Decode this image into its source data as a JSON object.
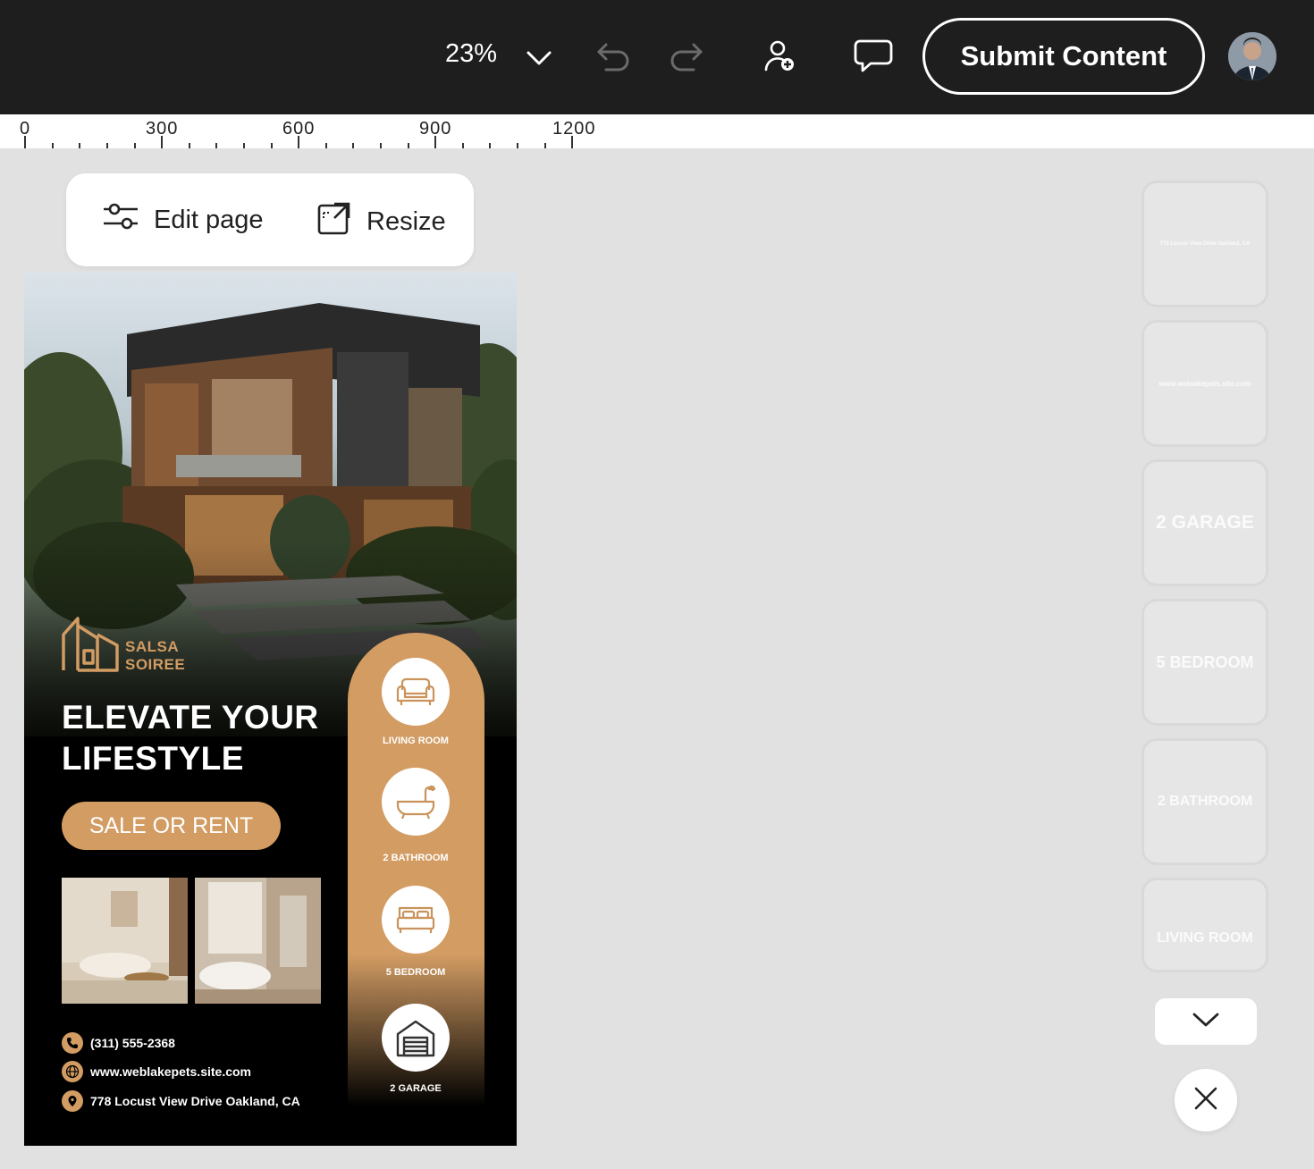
{
  "toolbar": {
    "zoom_value": "23%",
    "submit_label": "Submit Content"
  },
  "ruler": {
    "labels": [
      "0",
      "300",
      "600",
      "900",
      "1200"
    ]
  },
  "edit_bar": {
    "edit_page_label": "Edit page",
    "resize_label": "Resize"
  },
  "poster": {
    "brand_line1": "SALSA",
    "brand_line2": "SOIREE",
    "headline_line1": "ELEVATE YOUR",
    "headline_line2": "LIFESTYLE",
    "cta_label": "SALE OR RENT",
    "phone": "(311) 555-2368",
    "website": "www.weblakepets.site.com",
    "address": "778 Locust View Drive Oakland, CA",
    "features": [
      {
        "label": "LIVING ROOM",
        "icon": "sofa-icon"
      },
      {
        "label": "2 BATHROOM",
        "icon": "bathtub-icon"
      },
      {
        "label": "5 BEDROOM",
        "icon": "bed-icon"
      },
      {
        "label": "2 GARAGE",
        "icon": "garage-icon"
      }
    ]
  },
  "thumbnails": [
    {
      "label": "778 Locust View Drive Oakland, CA"
    },
    {
      "label": "www.weblakepets.site.com"
    },
    {
      "label": "2 GARAGE"
    },
    {
      "label": "5 BEDROOM"
    },
    {
      "label": "2 BATHROOM"
    },
    {
      "label": "LIVING ROOM"
    }
  ],
  "colors": {
    "topbar": "#1e1e1e",
    "canvas": "#e1e1e1",
    "accent": "#d29c63"
  }
}
